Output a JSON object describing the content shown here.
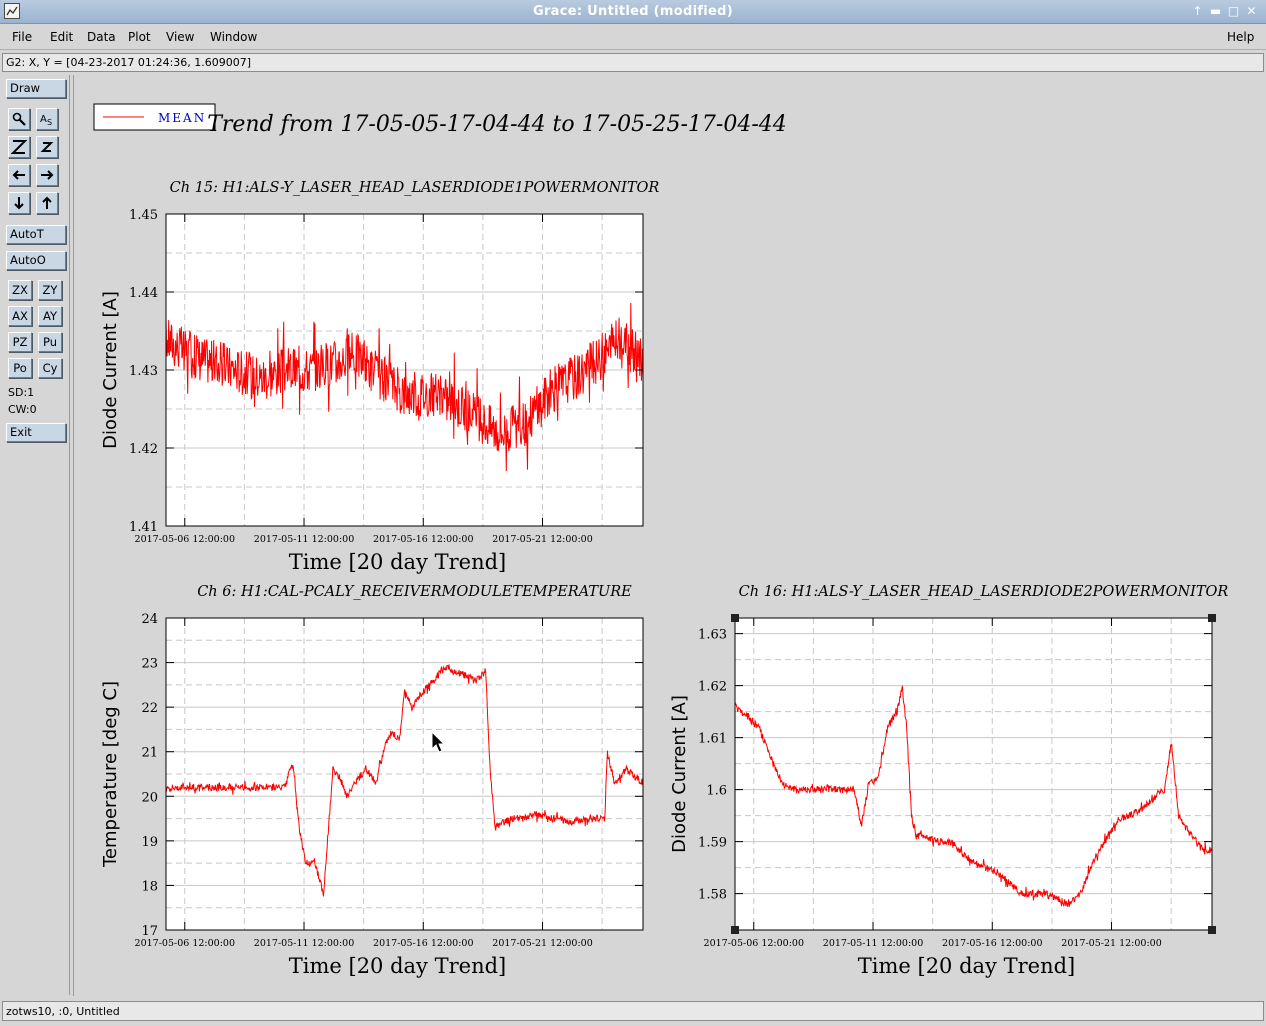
{
  "window": {
    "title": "Grace: Untitled (modified)"
  },
  "menu": {
    "file": "File",
    "edit": "Edit",
    "data": "Data",
    "plot": "Plot",
    "view": "View",
    "window": "Window",
    "help": "Help"
  },
  "location": "G2: X, Y = [04-23-2017 01:24:36, 1.609007]",
  "toolbar": {
    "draw": "Draw",
    "autot": "AutoT",
    "autoo": "AutoO",
    "zx": "ZX",
    "zy": "ZY",
    "ax": "AX",
    "ay": "AY",
    "pz": "PZ",
    "pu": "Pu",
    "po": "Po",
    "cy": "Cy",
    "sd": "SD:1",
    "cw": "CW:0",
    "exit": "Exit"
  },
  "status": "zotws10, :0, Untitled",
  "colors": {
    "trace": "#ff0000",
    "legend_text": "#0000c0",
    "grid": "#c8c8c8"
  },
  "legend": {
    "label": "MEAN"
  },
  "page_title": "Trend from 17-05-05-17-04-44 to 17-05-25-17-04-44",
  "chart_data": [
    {
      "type": "line",
      "title": "Ch 15: H1:ALS-Y_LASER_HEAD_LASERDIODE1POWERMONITOR",
      "xlabel": "Time [20 day Trend]",
      "ylabel": "Diode Current [A]",
      "x_range": [
        "2017-05-05 17:04:44",
        "2017-05-25 17:04:44"
      ],
      "ylim": [
        1.41,
        1.45
      ],
      "y_ticks": [
        "1.45",
        "1.44",
        "1.43",
        "1.42",
        "1.41"
      ],
      "x_ticks": [
        "2017-05-06 12:00:00",
        "2017-05-11 12:00:00",
        "2017-05-16 12:00:00",
        "2017-05-21 12:00:00"
      ],
      "series": [
        {
          "x_days": [
            0,
            1,
            2,
            3,
            4,
            5,
            6,
            7,
            8,
            9,
            10,
            11,
            12,
            13,
            14,
            15,
            16,
            17,
            18,
            19,
            20
          ],
          "values": [
            1.434,
            1.432,
            1.431,
            1.43,
            1.429,
            1.43,
            1.43,
            1.431,
            1.432,
            1.429,
            1.427,
            1.427,
            1.426,
            1.424,
            1.422,
            1.423,
            1.427,
            1.429,
            1.431,
            1.434,
            1.431
          ],
          "noise": 0.003
        }
      ]
    },
    {
      "type": "line",
      "title": "Ch 6: H1:CAL-PCALY_RECEIVERMODULETEMPERATURE",
      "xlabel": "Time [20 day Trend]",
      "ylabel": "Temperature [deg C]",
      "x_range": [
        "2017-05-05 17:04:44",
        "2017-05-25 17:04:44"
      ],
      "ylim": [
        17,
        24
      ],
      "y_ticks": [
        "24",
        "23",
        "22",
        "21",
        "20",
        "19",
        "18",
        "17"
      ],
      "x_ticks": [
        "2017-05-06 12:00:00",
        "2017-05-11 12:00:00",
        "2017-05-16 12:00:00",
        "2017-05-21 12:00:00"
      ],
      "series": [
        {
          "x_days": [
            0,
            2,
            4,
            5.0,
            5.3,
            5.6,
            5.9,
            6.2,
            6.6,
            7.0,
            7.3,
            7.6,
            7.9,
            8.4,
            8.8,
            9.2,
            9.5,
            9.8,
            10.0,
            10.3,
            10.7,
            11.2,
            11.7,
            12.1,
            12.6,
            13.0,
            13.4,
            13.6,
            13.8,
            14.1,
            14.5,
            15.0,
            15.5,
            16.0,
            16.5,
            17.0,
            17.5,
            18.0,
            18.4,
            18.5,
            18.8,
            19.3,
            20.0
          ],
          "values": [
            20.2,
            20.2,
            20.2,
            20.2,
            20.8,
            19.2,
            18.4,
            18.6,
            17.8,
            20.6,
            20.4,
            20.0,
            20.3,
            20.6,
            20.3,
            21.2,
            21.4,
            21.3,
            22.4,
            22.0,
            22.3,
            22.6,
            22.9,
            22.8,
            22.7,
            22.6,
            22.8,
            20.5,
            19.3,
            19.4,
            19.5,
            19.5,
            19.6,
            19.5,
            19.5,
            19.4,
            19.5,
            19.5,
            19.5,
            21.0,
            20.3,
            20.6,
            20.3
          ],
          "noise": 0.08
        }
      ]
    },
    {
      "type": "line",
      "title": "Ch 16: H1:ALS-Y_LASER_HEAD_LASERDIODE2POWERMONITOR",
      "xlabel": "Time [20 day Trend]",
      "ylabel": "Diode Current [A]",
      "x_range": [
        "2017-05-05 17:04:44",
        "2017-05-25 17:04:44"
      ],
      "ylim": [
        1.573,
        1.633
      ],
      "y_ticks": [
        "1.63",
        "1.62",
        "1.61",
        "1.6",
        "1.59",
        "1.58"
      ],
      "x_ticks": [
        "2017-05-06 12:00:00",
        "2017-05-11 12:00:00",
        "2017-05-16 12:00:00",
        "2017-05-21 12:00:00"
      ],
      "series": [
        {
          "x_days": [
            0,
            1,
            1.5,
            2.0,
            2.5,
            3.0,
            4.0,
            5.0,
            5.3,
            5.6,
            6.0,
            6.4,
            6.8,
            7.0,
            7.2,
            7.4,
            7.6,
            8.0,
            8.4,
            9.0,
            10.0,
            10.5,
            11.0,
            12.0,
            13.0,
            14.0,
            14.5,
            15.0,
            16.0,
            17.0,
            17.5,
            18.0,
            18.3,
            18.6,
            19.0,
            19.5,
            20.0
          ],
          "values": [
            1.616,
            1.612,
            1.606,
            1.601,
            1.6,
            1.6,
            1.6,
            1.6,
            1.593,
            1.601,
            1.602,
            1.612,
            1.615,
            1.62,
            1.612,
            1.595,
            1.591,
            1.591,
            1.59,
            1.59,
            1.586,
            1.585,
            1.584,
            1.58,
            1.58,
            1.578,
            1.58,
            1.586,
            1.594,
            1.596,
            1.598,
            1.6,
            1.609,
            1.595,
            1.592,
            1.589,
            1.588
          ],
          "noise": 0.0007
        }
      ]
    }
  ]
}
